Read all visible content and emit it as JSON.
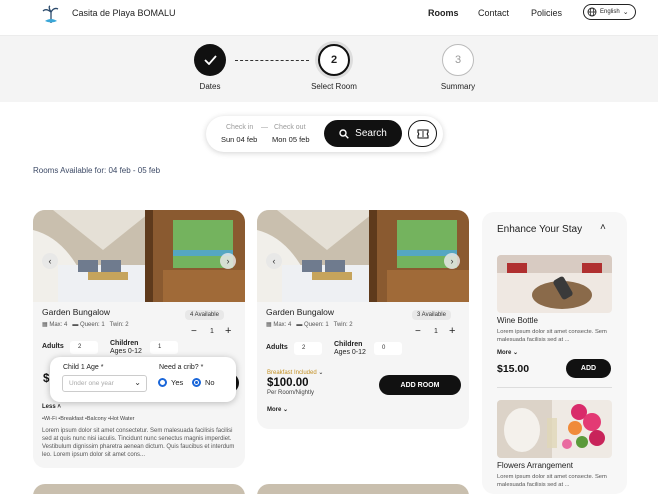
{
  "header": {
    "brand": "Casita de Playa BOMALU",
    "nav": [
      "Rooms",
      "Contact",
      "Policies"
    ],
    "language": "English"
  },
  "stepper": {
    "steps": [
      {
        "label": "Dates",
        "number": "",
        "state": "done"
      },
      {
        "label": "Select Room",
        "number": "2",
        "state": "active"
      },
      {
        "label": "Summary",
        "number": "3",
        "state": "pending"
      }
    ]
  },
  "search": {
    "checkin_label": "Check in",
    "checkin_value": "Sun 04 feb",
    "separator": "—",
    "checkout_label": "Check out",
    "checkout_value": "Mon 05 feb",
    "button_label": "Search"
  },
  "availability_text": "Rooms Available for: 04 feb - 05 feb",
  "rooms": [
    {
      "title": "Garden Bungalow",
      "available": "4 Available",
      "max": "Max: 4",
      "queen": "Queen: 1",
      "twin": "Twin: 2",
      "quantity": "1",
      "adults_label": "Adults",
      "adults_value": "2",
      "children_label": "Children",
      "children_sub": "Ages 0-12",
      "children_value": "1",
      "price_visible": "$",
      "less_label": "Less",
      "amenities": "•Wi-Fi  •Breakfast  •Balcony  •Hot Water",
      "description": "Lorem ipsum dolor sit amet consectetur. Sem malesuada facilisis facilisi sed at quis nunc nisi iaculis. Tincidunt nunc senectus magnis imperdiet. Vestibulum dignissim pharetra aenean dictum. Quis faucibus et interdum leo. Lorem ipsum dolor sit amet cons..."
    },
    {
      "title": "Garden Bungalow",
      "available": "3 Available",
      "max": "Max: 4",
      "queen": "Queen: 1",
      "twin": "Twin: 2",
      "quantity": "1",
      "adults_label": "Adults",
      "adults_value": "2",
      "children_label": "Children",
      "children_sub": "Ages 0-12",
      "children_value": "0",
      "breakfast": "Breakfast Included",
      "price": "$100.00",
      "per": "Per Room/Nightly",
      "add_label": "ADD ROOM",
      "more_label": "More"
    }
  ],
  "child_popup": {
    "age_label": "Child 1 Age *",
    "age_placeholder": "Under one year",
    "crib_label": "Need a crib? *",
    "yes": "Yes",
    "no": "No",
    "selected": "No"
  },
  "enhance": {
    "title": "Enhance Your Stay",
    "items": [
      {
        "title": "Wine Bottle",
        "description": "Lorem ipsum dolor sit amet consecte. Sem malesuada facilisis sed at ...",
        "more": "More",
        "price": "$15.00",
        "add": "ADD"
      },
      {
        "title": "Flowers Arrangement",
        "description": "Lorem ipsum dolor sit amet consecte. Sem malesuada facilisis sed at ..."
      }
    ]
  }
}
